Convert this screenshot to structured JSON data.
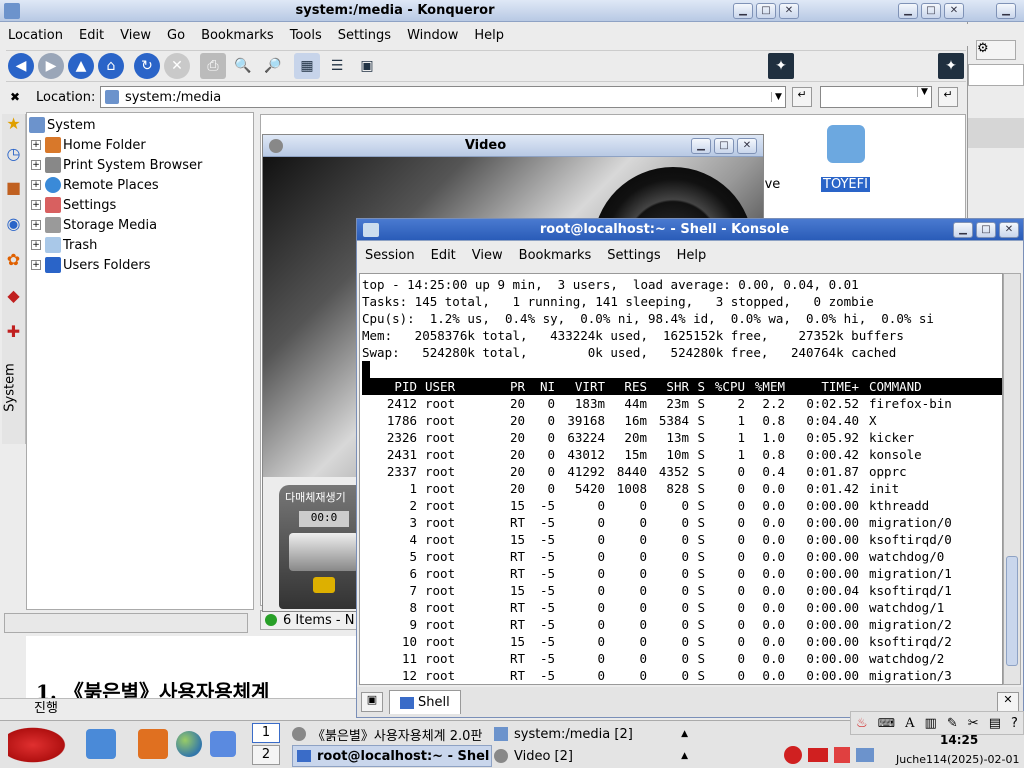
{
  "konqueror": {
    "title": "system:/media - Konqueror",
    "menu": [
      "Location",
      "Edit",
      "View",
      "Go",
      "Bookmarks",
      "Tools",
      "Settings",
      "Window",
      "Help"
    ],
    "location_label": "Location:",
    "location_value": "system:/media",
    "sidebar_tab": "System",
    "tree": [
      {
        "label": "System",
        "root": true
      },
      {
        "label": "Home Folder"
      },
      {
        "label": "Print System Browser"
      },
      {
        "label": "Remote Places"
      },
      {
        "label": "Settings"
      },
      {
        "label": "Storage Media"
      },
      {
        "label": "Trash"
      },
      {
        "label": "Users Folders"
      }
    ],
    "status": "6 Items - N",
    "media_labels": [
      "ive",
      "TOYEFI"
    ]
  },
  "video": {
    "title": "Video",
    "player_label": "다매체재생기",
    "player_display": "00:0"
  },
  "konsole": {
    "title": "root@localhost:~ - Shell - Konsole",
    "menu": [
      "Session",
      "Edit",
      "View",
      "Bookmarks",
      "Settings",
      "Help"
    ],
    "summary": [
      "top - 14:25:00 up 9 min,  3 users,  load average: 0.00, 0.04, 0.01",
      "Tasks: 145 total,   1 running, 141 sleeping,   3 stopped,   0 zombie",
      "Cpu(s):  1.2% us,  0.4% sy,  0.0% ni, 98.4% id,  0.0% wa,  0.0% hi,  0.0% si",
      "Mem:   2058376k total,   433224k used,  1625152k free,    27352k buffers",
      "Swap:   524280k total,        0k used,   524280k free,   240764k cached"
    ],
    "columns": [
      "PID",
      "USER",
      "PR",
      "NI",
      "VIRT",
      "RES",
      "SHR",
      "S",
      "%CPU",
      "%MEM",
      "TIME+",
      "COMMAND"
    ],
    "rows": [
      [
        "2412",
        "root",
        "20",
        "0",
        "183m",
        "44m",
        "23m",
        "S",
        "2",
        "2.2",
        "0:02.52",
        "firefox-bin"
      ],
      [
        "1786",
        "root",
        "20",
        "0",
        "39168",
        "16m",
        "5384",
        "S",
        "1",
        "0.8",
        "0:04.40",
        "X"
      ],
      [
        "2326",
        "root",
        "20",
        "0",
        "63224",
        "20m",
        "13m",
        "S",
        "1",
        "1.0",
        "0:05.92",
        "kicker"
      ],
      [
        "2431",
        "root",
        "20",
        "0",
        "43012",
        "15m",
        "10m",
        "S",
        "1",
        "0.8",
        "0:00.42",
        "konsole"
      ],
      [
        "2337",
        "root",
        "20",
        "0",
        "41292",
        "8440",
        "4352",
        "S",
        "0",
        "0.4",
        "0:01.87",
        "opprc"
      ],
      [
        "1",
        "root",
        "20",
        "0",
        "5420",
        "1008",
        "828",
        "S",
        "0",
        "0.0",
        "0:01.42",
        "init"
      ],
      [
        "2",
        "root",
        "15",
        "-5",
        "0",
        "0",
        "0",
        "S",
        "0",
        "0.0",
        "0:00.00",
        "kthreadd"
      ],
      [
        "3",
        "root",
        "RT",
        "-5",
        "0",
        "0",
        "0",
        "S",
        "0",
        "0.0",
        "0:00.00",
        "migration/0"
      ],
      [
        "4",
        "root",
        "15",
        "-5",
        "0",
        "0",
        "0",
        "S",
        "0",
        "0.0",
        "0:00.00",
        "ksoftirqd/0"
      ],
      [
        "5",
        "root",
        "RT",
        "-5",
        "0",
        "0",
        "0",
        "S",
        "0",
        "0.0",
        "0:00.00",
        "watchdog/0"
      ],
      [
        "6",
        "root",
        "RT",
        "-5",
        "0",
        "0",
        "0",
        "S",
        "0",
        "0.0",
        "0:00.00",
        "migration/1"
      ],
      [
        "7",
        "root",
        "15",
        "-5",
        "0",
        "0",
        "0",
        "S",
        "0",
        "0.0",
        "0:00.04",
        "ksoftirqd/1"
      ],
      [
        "8",
        "root",
        "RT",
        "-5",
        "0",
        "0",
        "0",
        "S",
        "0",
        "0.0",
        "0:00.00",
        "watchdog/1"
      ],
      [
        "9",
        "root",
        "RT",
        "-5",
        "0",
        "0",
        "0",
        "S",
        "0",
        "0.0",
        "0:00.00",
        "migration/2"
      ],
      [
        "10",
        "root",
        "15",
        "-5",
        "0",
        "0",
        "0",
        "S",
        "0",
        "0.0",
        "0:00.00",
        "ksoftirqd/2"
      ],
      [
        "11",
        "root",
        "RT",
        "-5",
        "0",
        "0",
        "0",
        "S",
        "0",
        "0.0",
        "0:00.00",
        "watchdog/2"
      ],
      [
        "12",
        "root",
        "RT",
        "-5",
        "0",
        "0",
        "0",
        "S",
        "0",
        "0.0",
        "0:00.00",
        "migration/3"
      ]
    ],
    "tab_label": "Shell"
  },
  "background_doc": {
    "heading": "1. 《붉은별》사용자용체계",
    "status": "진행"
  },
  "taskbar": {
    "desktops": [
      "1",
      "2"
    ],
    "tasks": [
      "《붉은별》사용자용체계 2.0판",
      "system:/media [2]",
      "root@localhost:~ - Shel",
      "Video [2]"
    ],
    "time": "14:25",
    "date": "Juche114(2025)-02-01"
  },
  "colors": {
    "accent": "#2a64c8",
    "terminal_header": "#000000",
    "taskbar_bg": "#e4e4e4"
  }
}
